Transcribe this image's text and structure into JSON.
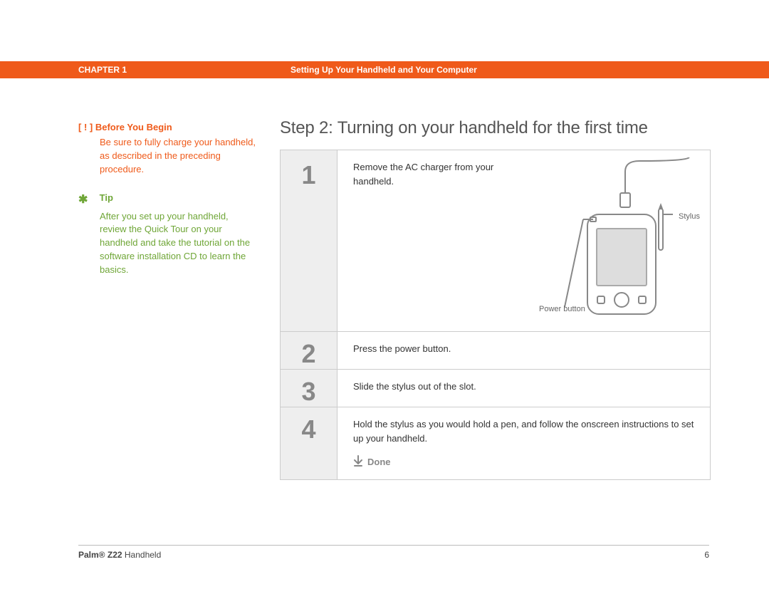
{
  "header": {
    "chapter": "CHAPTER 1",
    "section": "Setting Up Your Handheld and Your Computer"
  },
  "sidebar": {
    "before": {
      "marker": "[ ! ]",
      "title": "Before You Begin",
      "body": "Be sure to fully charge your handheld, as described in the preceding procedure."
    },
    "tip": {
      "star": "✱",
      "title": "Tip",
      "body": "After you set up your handheld, review the Quick Tour on your handheld and take the tutorial on the software installation CD to learn the basics."
    }
  },
  "main": {
    "heading": "Step 2: Turning on your handheld for the first time",
    "rows": [
      {
        "num": "1",
        "text": "Remove the AC charger from your handheld."
      },
      {
        "num": "2",
        "text": "Press the power button."
      },
      {
        "num": "3",
        "text": "Slide the stylus out of the slot."
      },
      {
        "num": "4",
        "text": "Hold the stylus as you would hold a pen, and follow the onscreen instructions to set up your handheld."
      }
    ],
    "done_label": "Done",
    "illustration": {
      "stylus_label": "Stylus",
      "power_label": "Power button"
    }
  },
  "footer": {
    "product_bold": "Palm® Z22",
    "product_rest": " Handheld",
    "page": "6"
  }
}
